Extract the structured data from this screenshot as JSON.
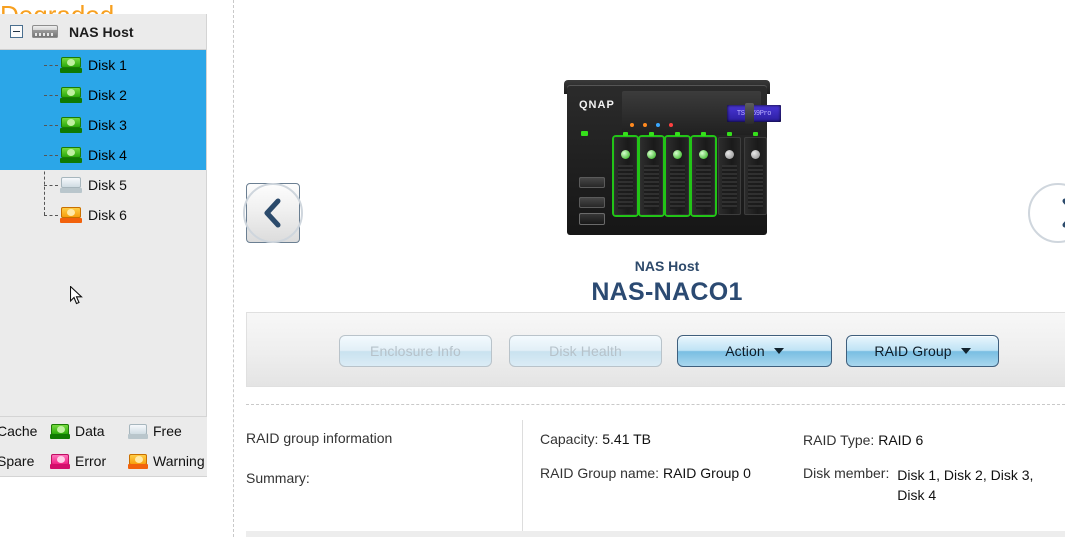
{
  "sidebar": {
    "host": {
      "label": "NAS Host",
      "icon": "nas-host-icon",
      "expander": "collapse-toggle"
    },
    "disks": [
      {
        "label": "Disk 1",
        "state": "data",
        "selected": true
      },
      {
        "label": "Disk 2",
        "state": "data",
        "selected": true
      },
      {
        "label": "Disk 3",
        "state": "data",
        "selected": true
      },
      {
        "label": "Disk 4",
        "state": "data",
        "selected": true
      },
      {
        "label": "Disk 5",
        "state": "free",
        "selected": false
      },
      {
        "label": "Disk 6",
        "state": "warning",
        "selected": false
      }
    ],
    "legend": {
      "row1": [
        {
          "label": "Cache",
          "state": "cache"
        },
        {
          "label": "Data",
          "state": "data"
        },
        {
          "label": "Free",
          "state": "free"
        }
      ],
      "row2": [
        {
          "label": "Spare",
          "state": "spare"
        },
        {
          "label": "Error",
          "state": "error"
        },
        {
          "label": "Warning",
          "state": "warning"
        }
      ]
    }
  },
  "device": {
    "brand": "QNAP",
    "lcd_text": "TS-669Pro",
    "bay_count": 6,
    "active_bays": 4,
    "subtitle": "NAS Host",
    "name": "NAS-NACO1"
  },
  "nav": {
    "prev": "previous-enclosure",
    "next": "next-enclosure"
  },
  "toolbar": {
    "enclosure_info": "Enclosure Info",
    "disk_health": "Disk Health",
    "action": "Action",
    "raid_group": "RAID Group"
  },
  "raid_info": {
    "title": "RAID group information",
    "summary_label": "Summary:",
    "summary_value": "Degraded",
    "summary_color": "#f7a020",
    "capacity_label": "Capacity:",
    "capacity_value": "5.41 TB",
    "group_name_label": "RAID Group name:",
    "group_name_value": "RAID Group 0",
    "raid_type_label": "RAID Type:",
    "raid_type_value": "RAID 6",
    "disk_member_label": "Disk member:",
    "disk_member_value": "Disk 1, Disk 2, Disk 3, Disk 4"
  }
}
